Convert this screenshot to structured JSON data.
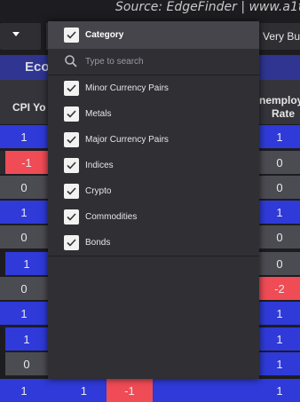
{
  "source_text": "Source: EdgeFinder | www.a1t",
  "controls": {
    "right_label": "Very Bu"
  },
  "banner": {
    "title": "Eco"
  },
  "columns": {
    "left_header": "CPI Yo",
    "right_header_line1": "nemploy",
    "right_header_line2": "Rate"
  },
  "left_col": [
    "1",
    "-1",
    "0",
    "1",
    "0",
    "1",
    "0",
    "1",
    "1",
    "0",
    "1"
  ],
  "right_col": [
    "1",
    "0",
    "0",
    "1",
    "0",
    "0",
    "-2",
    "1",
    "1",
    "1",
    "1"
  ],
  "bottom_row": {
    "v1": "1",
    "v2": "-1"
  },
  "dropdown": {
    "header_label": "Category",
    "search_placeholder": "Type to search",
    "items": [
      {
        "label": "Minor Currency Pairs",
        "checked": true
      },
      {
        "label": "Metals",
        "checked": true
      },
      {
        "label": "Major Currency Pairs",
        "checked": true
      },
      {
        "label": "Indices",
        "checked": true
      },
      {
        "label": "Crypto",
        "checked": true
      },
      {
        "label": "Commodities",
        "checked": true
      },
      {
        "label": "Bonds",
        "checked": true
      }
    ]
  },
  "colors": {
    "positive": "#2f3ad8",
    "neutral": "#4b4b52",
    "negative": "#f04c56",
    "banner": "#2f3591"
  },
  "icons": {
    "check": "check-icon",
    "search": "search-icon",
    "caret": "caret-down-icon"
  }
}
